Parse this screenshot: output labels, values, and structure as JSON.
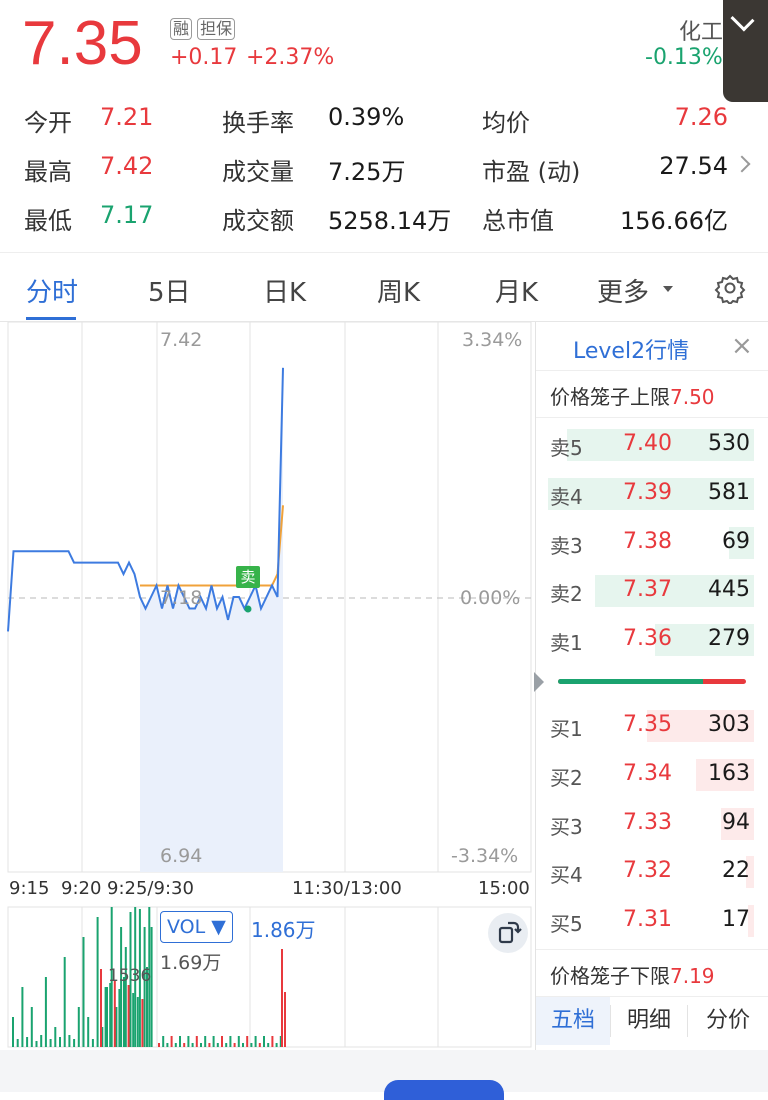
{
  "header": {
    "price": "7.35",
    "change": "+0.17",
    "change_pct": "+2.37%",
    "tag_margin": "融",
    "tag_collateral": "担保",
    "sector_name": "化工",
    "sector_change": "-0.13%"
  },
  "stats": {
    "open_label": "今开",
    "open": "7.21",
    "high_label": "最高",
    "high": "7.42",
    "low_label": "最低",
    "low": "7.17",
    "turnover_rate_label": "换手率",
    "turnover_rate": "0.39%",
    "volume_label": "成交量",
    "volume": "7.25万",
    "amount_label": "成交额",
    "amount": "5258.14万",
    "avg_label": "均价",
    "avg": "7.26",
    "pe_label": "市盈 (动)",
    "pe": "27.54",
    "mktcap_label": "总市值",
    "mktcap": "156.66亿"
  },
  "tabs": [
    "分时",
    "5日",
    "日K",
    "周K",
    "月K",
    "更多"
  ],
  "active_tab": "分时",
  "chart": {
    "price_top": "7.42",
    "price_bottom": "6.94",
    "price_mid": "7.18",
    "pct_top": "3.34%",
    "pct_mid": "0.00%",
    "pct_bottom": "-3.34%",
    "sell_marker": "卖",
    "time_labels": [
      "9:15",
      "9:20",
      "9:25/9:30",
      "11:30/13:00",
      "15:00"
    ],
    "vol_label": "VOL",
    "vol_total": "1.86万",
    "vol_max": "1.69万",
    "vol_ref": "1536"
  },
  "chart_data": {
    "type": "line",
    "title": "",
    "xlabel": "",
    "ylabel": "",
    "ylim": [
      6.94,
      7.42
    ],
    "series": [
      {
        "values": [
          7.15,
          7.22,
          7.22,
          7.22,
          7.22,
          7.22,
          7.22,
          7.22,
          7.22,
          7.22,
          7.22,
          7.22,
          7.21,
          7.21,
          7.21,
          7.21,
          7.21,
          7.21,
          7.21,
          7.21,
          7.21,
          7.2,
          7.21,
          7.2,
          7.18,
          7.17,
          7.18,
          7.19,
          7.17,
          7.19,
          7.17,
          7.19,
          7.18,
          7.17,
          7.17,
          7.18,
          7.17,
          7.19,
          7.17,
          7.18,
          7.16,
          7.18,
          7.18,
          7.17,
          7.18,
          7.19,
          7.17,
          7.18,
          7.19,
          7.18,
          7.38
        ]
      },
      {
        "values": [
          7.18,
          7.18,
          7.18,
          7.185,
          7.19,
          7.19,
          7.19,
          7.19,
          7.19,
          7.19,
          7.19,
          7.19,
          7.19,
          7.19,
          7.19,
          7.19,
          7.19,
          7.19,
          7.19,
          7.19,
          7.19,
          7.19,
          7.19,
          7.19,
          7.19,
          7.19,
          7.19,
          7.19,
          7.19,
          7.19,
          7.19,
          7.19,
          7.19,
          7.19,
          7.19,
          7.19,
          7.19,
          7.19,
          7.19,
          7.19,
          7.19,
          7.19,
          7.19,
          7.19,
          7.19,
          7.19,
          7.19,
          7.19,
          7.19,
          7.2,
          7.26
        ]
      }
    ]
  },
  "level2": {
    "title": "Level2行情",
    "upper_label": "价格笼子上限",
    "upper": "7.50",
    "lower_label": "价格笼子下限",
    "lower": "7.19",
    "asks": [
      {
        "name": "卖5",
        "price": "7.40",
        "vol": "530",
        "ratio": 0.91
      },
      {
        "name": "卖4",
        "price": "7.39",
        "vol": "581",
        "ratio": 1.0
      },
      {
        "name": "卖3",
        "price": "7.38",
        "vol": "69",
        "ratio": 0.12
      },
      {
        "name": "卖2",
        "price": "7.37",
        "vol": "445",
        "ratio": 0.77
      },
      {
        "name": "卖1",
        "price": "7.36",
        "vol": "279",
        "ratio": 0.48
      }
    ],
    "bids": [
      {
        "name": "买1",
        "price": "7.35",
        "vol": "303",
        "ratio": 0.52
      },
      {
        "name": "买2",
        "price": "7.34",
        "vol": "163",
        "ratio": 0.28
      },
      {
        "name": "买3",
        "price": "7.33",
        "vol": "94",
        "ratio": 0.16
      },
      {
        "name": "买4",
        "price": "7.32",
        "vol": "22",
        "ratio": 0.04
      },
      {
        "name": "买5",
        "price": "7.31",
        "vol": "17",
        "ratio": 0.03
      }
    ],
    "buy_ratio": 0.77,
    "tabs": [
      "五档",
      "明细",
      "分价"
    ]
  },
  "colors": {
    "up": "#e8393d",
    "down": "#1aa36f",
    "accent": "#2f6fd6"
  }
}
